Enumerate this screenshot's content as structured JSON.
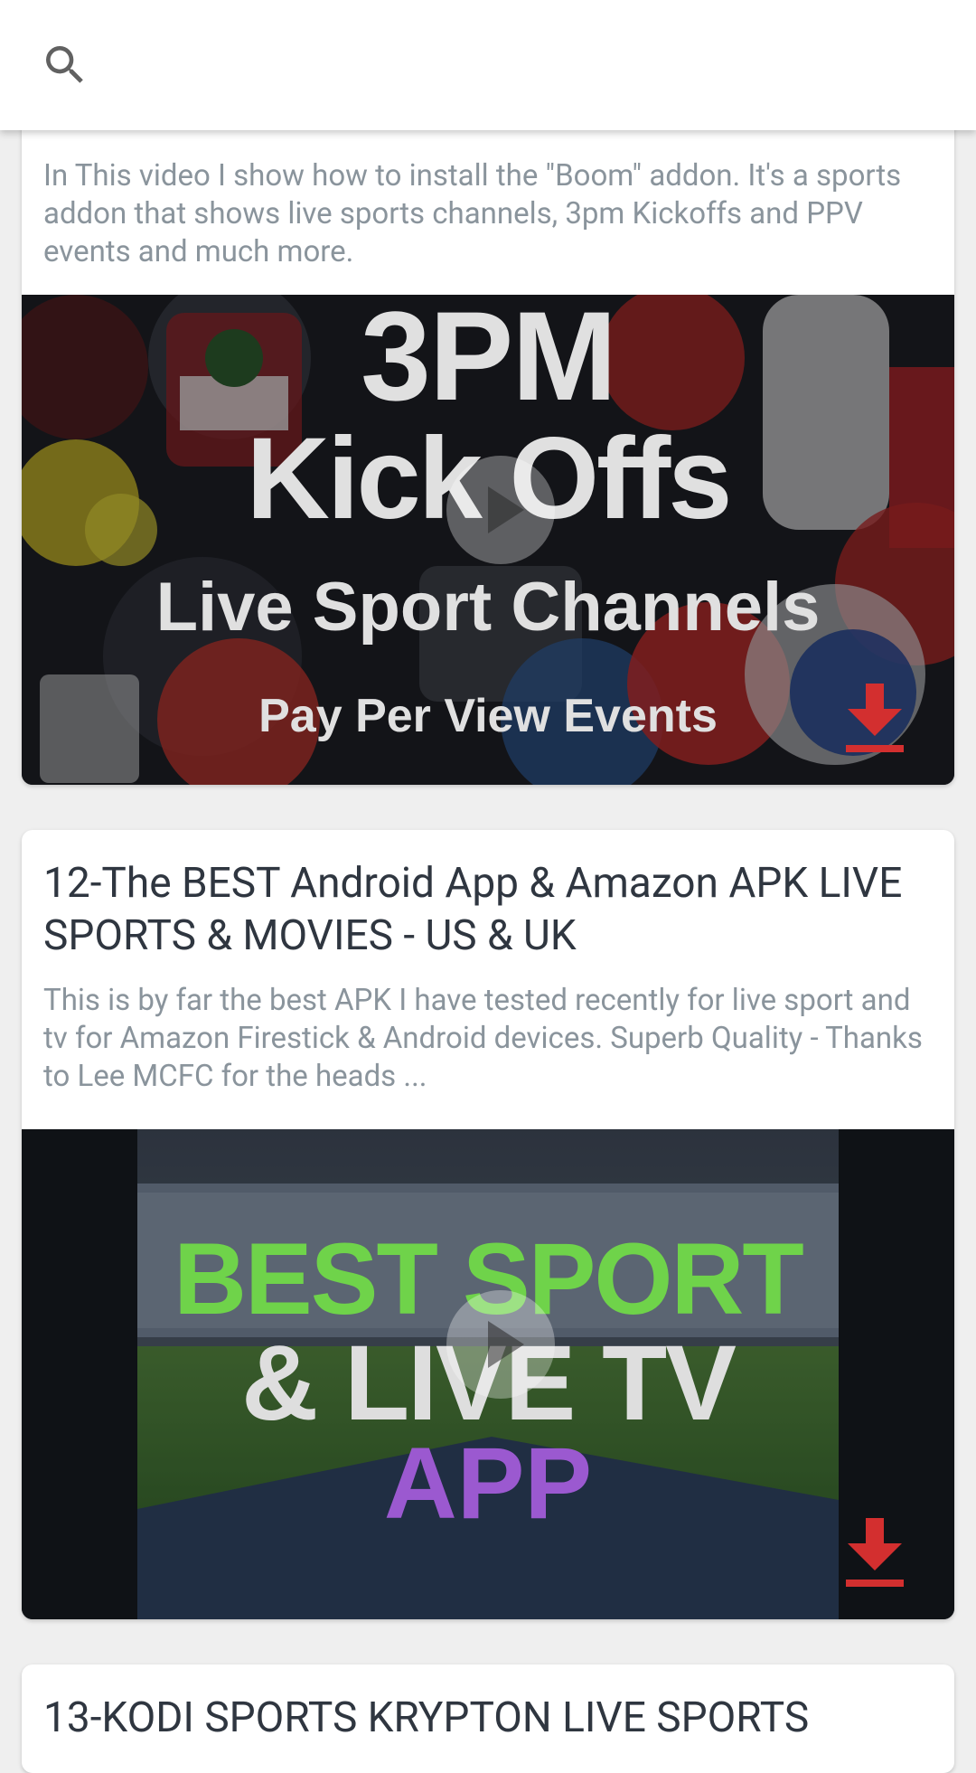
{
  "toolbar": {
    "search_icon": "search-icon"
  },
  "cards": [
    {
      "description": "In This video I show how to install the \"Boom\" addon. It's a sports addon that shows live sports channels, 3pm Kickoffs and PPV events and much more.",
      "thumbnail_text": [
        "3PM",
        "Kick Offs",
        "Live Sport Channels",
        "Pay Per View Events"
      ],
      "play_icon": "play-icon",
      "download_icon": "download-icon"
    },
    {
      "title": "12-The BEST Android App & Amazon APK LIVE SPORTS & MOVIES - US & UK",
      "description": "This is by far the best APK I have tested recently for live sport and tv for Amazon Firestick & Android devices. Superb Quality - Thanks to Lee MCFC for the heads ...",
      "thumbnail_text": [
        "BEST SPORT",
        "& LIVE TV",
        "APP"
      ],
      "play_icon": "play-icon",
      "download_icon": "download-icon"
    },
    {
      "title": "13-KODI SPORTS KRYPTON LIVE SPORTS"
    }
  ],
  "colors": {
    "download_red": "#d32f2f",
    "thumb_green": "#6fd34a",
    "thumb_purple": "#9b59d0",
    "thumb_light_text": "#dedede"
  }
}
